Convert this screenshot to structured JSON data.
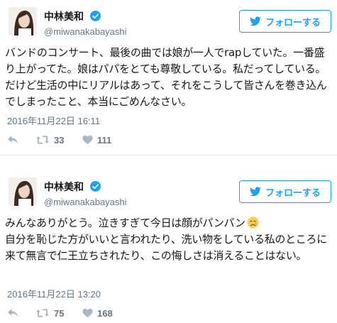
{
  "tweets": [
    {
      "display_name": "中林美和",
      "handle": "@miwanakabayashi",
      "follow_label": "フォローする",
      "text": "バンドのコンサート、最後の曲では娘が一人でrapしていた。一番盛り上がってた。娘はパパをとても尊敬している。私だってしている。だけど生活の中にリアルはあって、それをこうして皆さんを巻き込んでしまったこと、本当にごめんなさい。",
      "timestamp": "2016年11月22日 16:11",
      "retweets": "33",
      "likes": "111"
    },
    {
      "display_name": "中林美和",
      "handle": "@miwanakabayashi",
      "follow_label": "フォローする",
      "text": "みんなありがとう。泣きすぎて今日は顔がパンパン",
      "text_emoji": "crying-face-emoji",
      "text2": "自分を恥じた方がいいと言われたり、洗い物をしている私のところに来て無言で仁王立ちされたり、この悔しさは消えることはない。",
      "timestamp": "2016年11月22日 13:20",
      "retweets": "75",
      "likes": "168"
    }
  ],
  "icons": {
    "verified": "verified-badge-icon",
    "follow": "twitter-bird-icon",
    "reply": "reply-icon",
    "retweet": "retweet-icon",
    "like": "heart-icon"
  },
  "colors": {
    "accent": "#1da1f2",
    "muted": "#657786",
    "icon": "#aab8c2",
    "text": "#14171a"
  }
}
